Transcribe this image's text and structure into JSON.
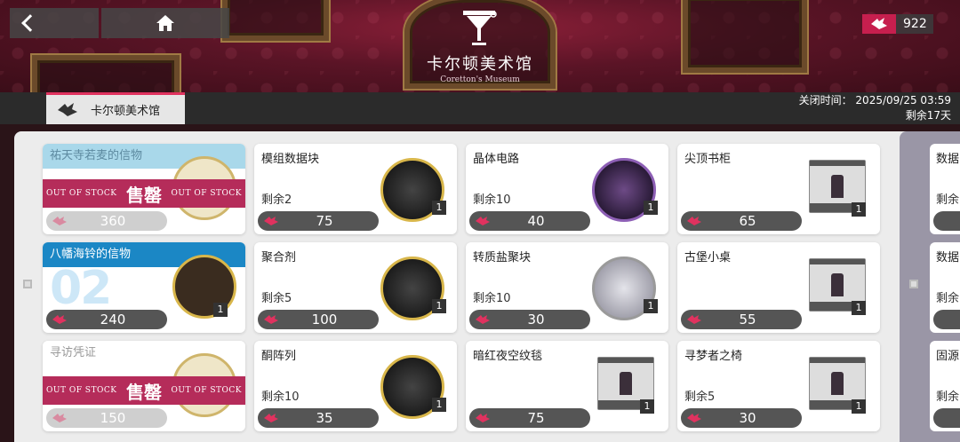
{
  "header": {
    "museum_name": "卡尔顿美术馆",
    "museum_name_en": "Coretton's Museum",
    "currency_amount": "922"
  },
  "tabbar": {
    "tab_label": "卡尔顿美术馆",
    "close_time": "关闭时间： 2025/09/25 03:59",
    "remaining_days": "剩余17天"
  },
  "relics": [
    {
      "name": "祐天寺若麦的信物",
      "price": "360",
      "status": "sold",
      "oos_left": "OUT OF STOCK",
      "oos_center": "售罄",
      "oos_right": "OUT OF STOCK"
    },
    {
      "name": "八幡海铃的信物",
      "price": "240",
      "status": "active",
      "number": "02",
      "qty": "1"
    },
    {
      "name": "寻访凭证",
      "price": "150",
      "status": "sold",
      "oos_left": "OUT OF STOCK",
      "oos_center": "售罄",
      "oos_right": "OUT OF STOCK"
    }
  ],
  "items": [
    {
      "name": "模组数据块",
      "stock": "剩余2",
      "price": "75",
      "qty": "1"
    },
    {
      "name": "晶体电路",
      "stock": "剩余10",
      "price": "40",
      "qty": "1"
    },
    {
      "name": "尖顶书柜",
      "stock": "",
      "price": "65",
      "qty": "1"
    },
    {
      "name": "聚合剂",
      "stock": "剩余5",
      "price": "100",
      "qty": "1"
    },
    {
      "name": "转质盐聚块",
      "stock": "剩余10",
      "price": "30",
      "qty": "1"
    },
    {
      "name": "古堡小桌",
      "stock": "",
      "price": "55",
      "qty": "1"
    },
    {
      "name": "酮阵列",
      "stock": "剩余10",
      "price": "35",
      "qty": "1"
    },
    {
      "name": "暗红夜空纹毯",
      "stock": "",
      "price": "75",
      "qty": "1"
    },
    {
      "name": "寻梦者之椅",
      "stock": "剩余5",
      "price": "30",
      "qty": "1"
    }
  ],
  "edge_items": [
    {
      "name": "数据",
      "stock": "剩余"
    },
    {
      "name": "数据",
      "stock": "剩余"
    },
    {
      "name": "固源",
      "stock": "剩余"
    }
  ],
  "colors": {
    "accent": "#e0325f",
    "active_blue": "#1b87c5",
    "soldout_red": "#b52c5a"
  }
}
